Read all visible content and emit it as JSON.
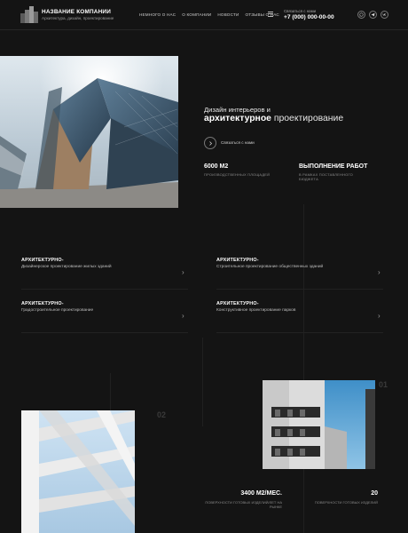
{
  "header": {
    "brand_name": "НАЗВАНИЕ КОМПАНИИ",
    "brand_sub": "Архитектура, дизайн, проектирование",
    "nav": [
      "НЕМНОГО О НАС",
      "О КОМПАНИИ",
      "НОВОСТИ",
      "ОТЗЫВЫ О НАС"
    ],
    "callme": "Связаться с нами",
    "phone": "+7 (000) 000-00-00",
    "socials": [
      "whatsapp-icon",
      "telegram-icon",
      "vk-icon"
    ]
  },
  "hero": {
    "line1": "Дизайн интерьеров и",
    "line2_bold": "архитектурное",
    "line2_rest": " проектирование",
    "cta": "Связаться с нами",
    "stats": [
      {
        "value": "6000 М2",
        "label": "ПРОИЗВОДСТВЕННЫХ ПЛОЩАДЕЙ"
      },
      {
        "value": "ВЫПОЛНЕНИЕ РАБОТ",
        "label": "В РАМКАХ ПОСТАВЛЕННОГО БЮДЖЕТА"
      }
    ]
  },
  "services": [
    {
      "title": "АРХИТЕКТУРНО-",
      "desc": "Дизайнерское проектирование жилых зданий"
    },
    {
      "title": "АРХИТЕКТУРНО-",
      "desc": "Строительное проектирование общественных зданий"
    },
    {
      "title": "АРХИТЕКТУРНО-",
      "desc": "Градостроительное проектирование"
    },
    {
      "title": "АРХИТЕКТУРНО-",
      "desc": "Конструктивное проектирование парков"
    }
  ],
  "gallery": {
    "num1": "01",
    "num2": "02",
    "stats": [
      {
        "value": "3400 М2/МЕС.",
        "label": "ПОВЕРХНОСТИ ГОТОВЫХ ИЗДЕЛИЙ/ЛЕТ НА РЫНКЕ"
      },
      {
        "value": "20",
        "label": "ПОВЕРХНОСТИ ГОТОВЫХ ИЗДЕЛИЙ"
      }
    ]
  }
}
